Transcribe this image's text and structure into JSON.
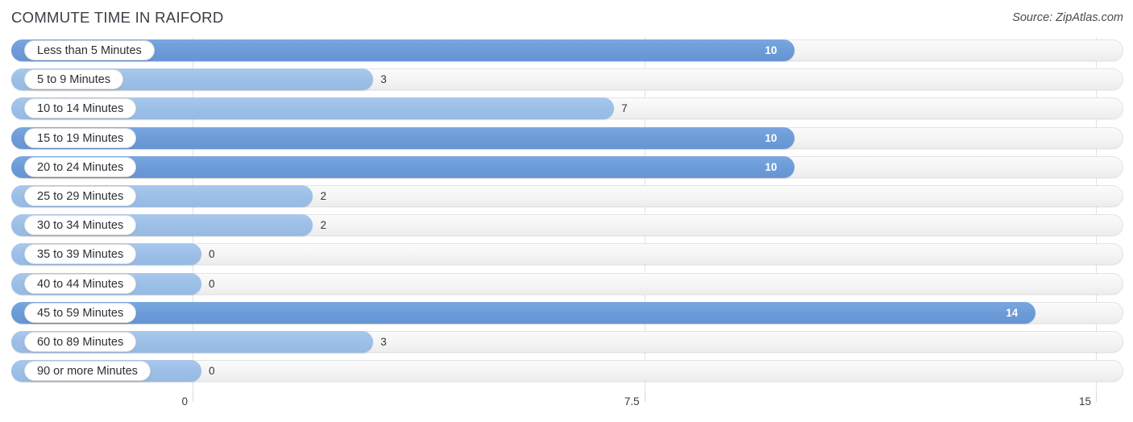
{
  "header": {
    "title": "COMMUTE TIME IN RAIFORD",
    "source": "Source: ZipAtlas.com"
  },
  "chart_data": {
    "type": "bar",
    "orientation": "horizontal",
    "title": "COMMUTE TIME IN RAIFORD",
    "subtitle": "",
    "xlabel": "",
    "ylabel": "",
    "xlim": [
      0,
      15
    ],
    "grid": true,
    "legend": false,
    "xticks": [
      "0",
      "7.5",
      "15"
    ],
    "xtick_values": [
      0,
      7.5,
      15
    ],
    "categories": [
      "Less than 5 Minutes",
      "5 to 9 Minutes",
      "10 to 14 Minutes",
      "15 to 19 Minutes",
      "20 to 24 Minutes",
      "25 to 29 Minutes",
      "30 to 34 Minutes",
      "35 to 39 Minutes",
      "40 to 44 Minutes",
      "45 to 59 Minutes",
      "60 to 89 Minutes",
      "90 or more Minutes"
    ],
    "values": [
      10,
      3,
      7,
      10,
      10,
      2,
      2,
      0,
      0,
      14,
      3,
      0
    ],
    "value_labels": [
      "10",
      "3",
      "7",
      "10",
      "10",
      "2",
      "2",
      "0",
      "0",
      "14",
      "3",
      "0"
    ],
    "colors": {
      "bar_high": "#6c9bd8",
      "bar_low": "#9cbfe7",
      "track": "#f4f4f4",
      "gridline": "#e2e2e4",
      "text": "#2e2e36",
      "value_inside": "#ffffff"
    }
  },
  "rows": [
    {
      "label": "Less than 5 Minutes",
      "value": "10",
      "inside": true,
      "shade": "dark"
    },
    {
      "label": "5 to 9 Minutes",
      "value": "3",
      "inside": false,
      "shade": "light"
    },
    {
      "label": "10 to 14 Minutes",
      "value": "7",
      "inside": false,
      "shade": "light"
    },
    {
      "label": "15 to 19 Minutes",
      "value": "10",
      "inside": true,
      "shade": "dark"
    },
    {
      "label": "20 to 24 Minutes",
      "value": "10",
      "inside": true,
      "shade": "dark"
    },
    {
      "label": "25 to 29 Minutes",
      "value": "2",
      "inside": false,
      "shade": "light"
    },
    {
      "label": "30 to 34 Minutes",
      "value": "2",
      "inside": false,
      "shade": "light"
    },
    {
      "label": "35 to 39 Minutes",
      "value": "0",
      "inside": false,
      "shade": "light"
    },
    {
      "label": "40 to 44 Minutes",
      "value": "0",
      "inside": false,
      "shade": "light"
    },
    {
      "label": "45 to 59 Minutes",
      "value": "14",
      "inside": true,
      "shade": "dark"
    },
    {
      "label": "60 to 89 Minutes",
      "value": "3",
      "inside": false,
      "shade": "light"
    },
    {
      "label": "90 or more Minutes",
      "value": "0",
      "inside": false,
      "shade": "light"
    }
  ],
  "axis": {
    "ticks": [
      "0",
      "7.5",
      "15"
    ]
  }
}
